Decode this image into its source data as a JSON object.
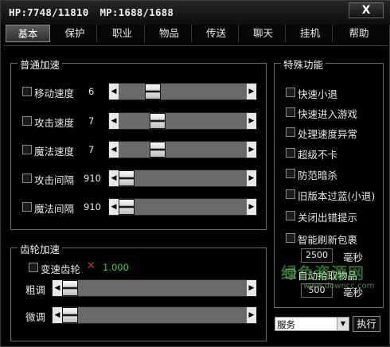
{
  "titlebar": {
    "hp": "HP:7748/11810",
    "mp": "MP:1688/1688",
    "close": "X"
  },
  "tabs": [
    "基本",
    "保护",
    "职业",
    "物品",
    "传送",
    "聊天",
    "挂机",
    "帮助"
  ],
  "speed_group": {
    "title": "普通加速",
    "rows": [
      {
        "label": "移动速度",
        "value": "6",
        "level": 0.22
      },
      {
        "label": "攻击速度",
        "value": "7",
        "level": 0.26
      },
      {
        "label": "魔法速度",
        "value": "7",
        "level": 0.26
      },
      {
        "label": "攻击间隔",
        "value": "910",
        "level": 0.0
      },
      {
        "label": "魔法间隔",
        "value": "910",
        "level": 0.0
      }
    ]
  },
  "gear_group": {
    "title": "齿轮加速",
    "toggle_label": "变速齿轮",
    "x_mark": "✕",
    "gear_value": "1.000",
    "coarse_label": "粗调",
    "fine_label": "微调"
  },
  "special_group": {
    "title": "特殊功能",
    "items": [
      "快速小退",
      "快速进入游戏",
      "处理速度异常",
      "超级不卡",
      "防范暗杀",
      "旧版本过蓝(小退)",
      "关闭出错提示"
    ],
    "smart_refresh": {
      "label": "智能刷新包裹",
      "value": "2500",
      "unit": "毫秒"
    },
    "auto_pick": {
      "label": "自动拾取物品",
      "value": "500",
      "unit": "毫秒"
    }
  },
  "bottom": {
    "select_value": "服务",
    "exec_label": "执行"
  },
  "watermark": {
    "main": "绿色资源网",
    "sub": "www.downcc.com"
  }
}
